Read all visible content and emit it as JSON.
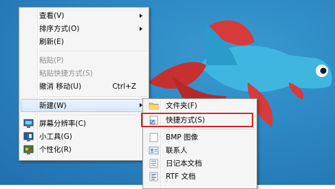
{
  "context_menu": {
    "items": [
      {
        "label": "查看(V)",
        "shortcut": "",
        "submenu": true,
        "disabled": false
      },
      {
        "label": "排序方式(O)",
        "shortcut": "",
        "submenu": true,
        "disabled": false
      },
      {
        "label": "刷新(E)",
        "shortcut": "",
        "submenu": false,
        "disabled": false
      },
      {
        "label": "粘贴(P)",
        "shortcut": "",
        "submenu": false,
        "disabled": true
      },
      {
        "label": "粘贴快捷方式(S)",
        "shortcut": "",
        "submenu": false,
        "disabled": true
      },
      {
        "label": "撤消 移动(U)",
        "shortcut": "Ctrl+Z",
        "submenu": false,
        "disabled": false
      },
      {
        "label": "新建(W)",
        "shortcut": "",
        "submenu": true,
        "disabled": false
      },
      {
        "label": "屏幕分辨率(C)",
        "shortcut": "",
        "submenu": false,
        "disabled": false,
        "icon": "display-icon"
      },
      {
        "label": "小工具(G)",
        "shortcut": "",
        "submenu": false,
        "disabled": false,
        "icon": "gadgets-icon"
      },
      {
        "label": "个性化(R)",
        "shortcut": "",
        "submenu": false,
        "disabled": false,
        "icon": "personalize-icon"
      }
    ]
  },
  "new_submenu": {
    "items": [
      {
        "label": "文件夹(F)",
        "icon": "folder-icon"
      },
      {
        "label": "快捷方式(S)",
        "icon": "shortcut-icon",
        "highlighted": true
      },
      {
        "label": "BMP 图像",
        "icon": "bitmap-icon"
      },
      {
        "label": "联系人",
        "icon": "contact-icon"
      },
      {
        "label": "日记本文档",
        "icon": "journal-icon"
      },
      {
        "label": "RTF 文档",
        "icon": "rtf-document-icon"
      }
    ]
  },
  "colors": {
    "desktop": "#2c86c2",
    "menu_bg": "#f5f5f5",
    "highlight_box": "#e02020",
    "fish_red": "#d63a3a",
    "fish_cyan": "#3fb6e0"
  }
}
